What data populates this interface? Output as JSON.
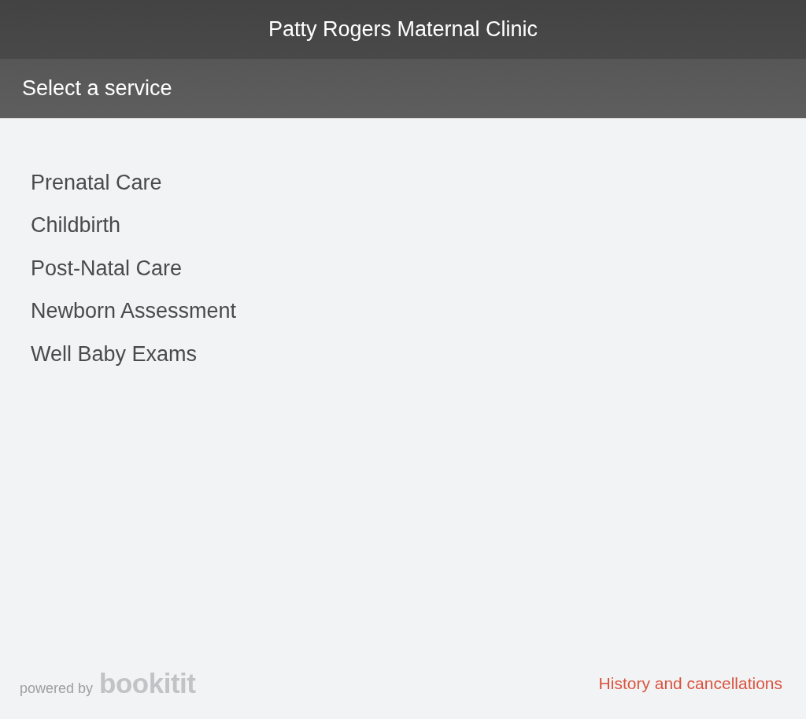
{
  "header": {
    "title": "Patty Rogers Maternal Clinic"
  },
  "subheader": {
    "title": "Select a service"
  },
  "services": [
    {
      "label": "Prenatal Care"
    },
    {
      "label": "Childbirth"
    },
    {
      "label": "Post-Natal Care"
    },
    {
      "label": "Newborn Assessment"
    },
    {
      "label": "Well Baby Exams"
    }
  ],
  "footer": {
    "powered_by": "powered by",
    "brand": "bookitit",
    "link": "History and cancellations"
  }
}
